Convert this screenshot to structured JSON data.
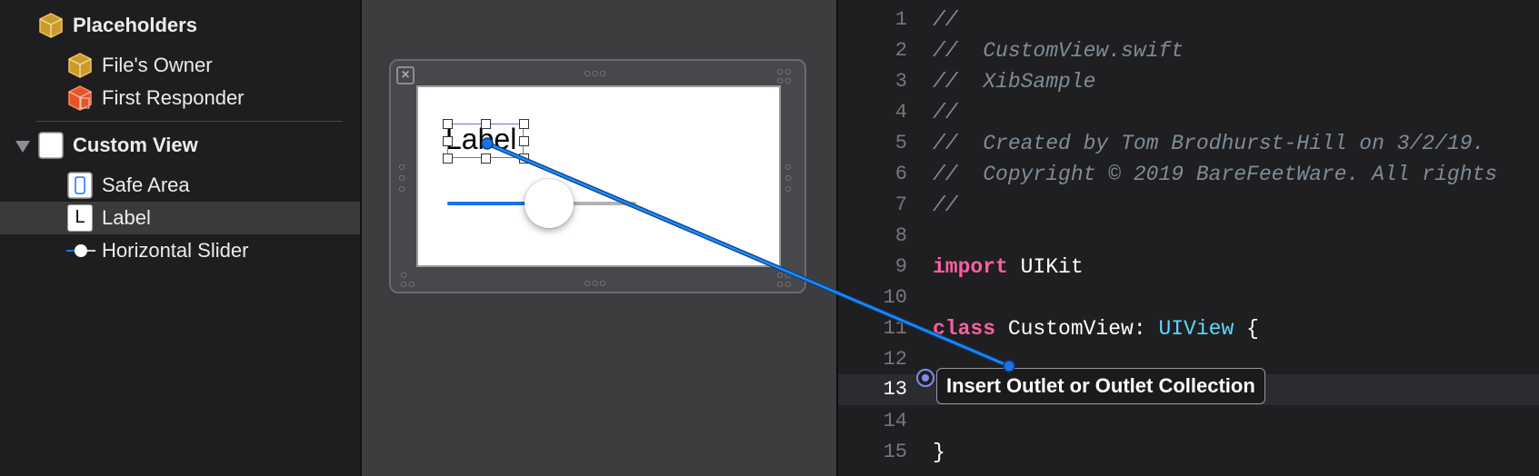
{
  "outline": {
    "placeholders_label": "Placeholders",
    "files_owner_label": "File's Owner",
    "first_responder_label": "First Responder",
    "custom_view_label": "Custom View",
    "safe_area_label": "Safe Area",
    "label_item_label": "Label",
    "label_icon_glyph": "L",
    "slider_label": "Horizontal Slider"
  },
  "canvas": {
    "label_text": "Label",
    "slider_value": 0.42
  },
  "editor": {
    "lines": [
      {
        "num": "1",
        "segments": [
          {
            "t": "//",
            "c": "comment"
          }
        ]
      },
      {
        "num": "2",
        "segments": [
          {
            "t": "//  CustomView.swift",
            "c": "comment"
          }
        ]
      },
      {
        "num": "3",
        "segments": [
          {
            "t": "//  XibSample",
            "c": "comment"
          }
        ]
      },
      {
        "num": "4",
        "segments": [
          {
            "t": "//",
            "c": "comment"
          }
        ]
      },
      {
        "num": "5",
        "segments": [
          {
            "t": "//  Created by Tom Brodhurst-Hill on 3/2/19.",
            "c": "comment"
          }
        ]
      },
      {
        "num": "6",
        "segments": [
          {
            "t": "//  Copyright © 2019 BareFeetWare. All rights",
            "c": "comment"
          }
        ]
      },
      {
        "num": "7",
        "segments": [
          {
            "t": "//",
            "c": "comment"
          }
        ]
      },
      {
        "num": "8",
        "segments": []
      },
      {
        "num": "9",
        "segments": [
          {
            "t": "import",
            "c": "kw"
          },
          {
            "t": " UIKit",
            "c": "plain"
          }
        ]
      },
      {
        "num": "10",
        "segments": []
      },
      {
        "num": "11",
        "segments": [
          {
            "t": "class",
            "c": "kw"
          },
          {
            "t": " CustomView: ",
            "c": "plain"
          },
          {
            "t": "UIView",
            "c": "type"
          },
          {
            "t": " {",
            "c": "plain"
          }
        ]
      },
      {
        "num": "12",
        "segments": []
      },
      {
        "num": "13",
        "segments": [],
        "current": true
      },
      {
        "num": "14",
        "segments": []
      },
      {
        "num": "15",
        "segments": [
          {
            "t": "}",
            "c": "plain"
          }
        ]
      }
    ],
    "tooltip": "Insert Outlet or Outlet Collection"
  },
  "colors": {
    "connection_line": "#1a73e8",
    "keyword": "#fc5fa3",
    "type": "#5dd8ff",
    "comment": "#7f8c98"
  }
}
